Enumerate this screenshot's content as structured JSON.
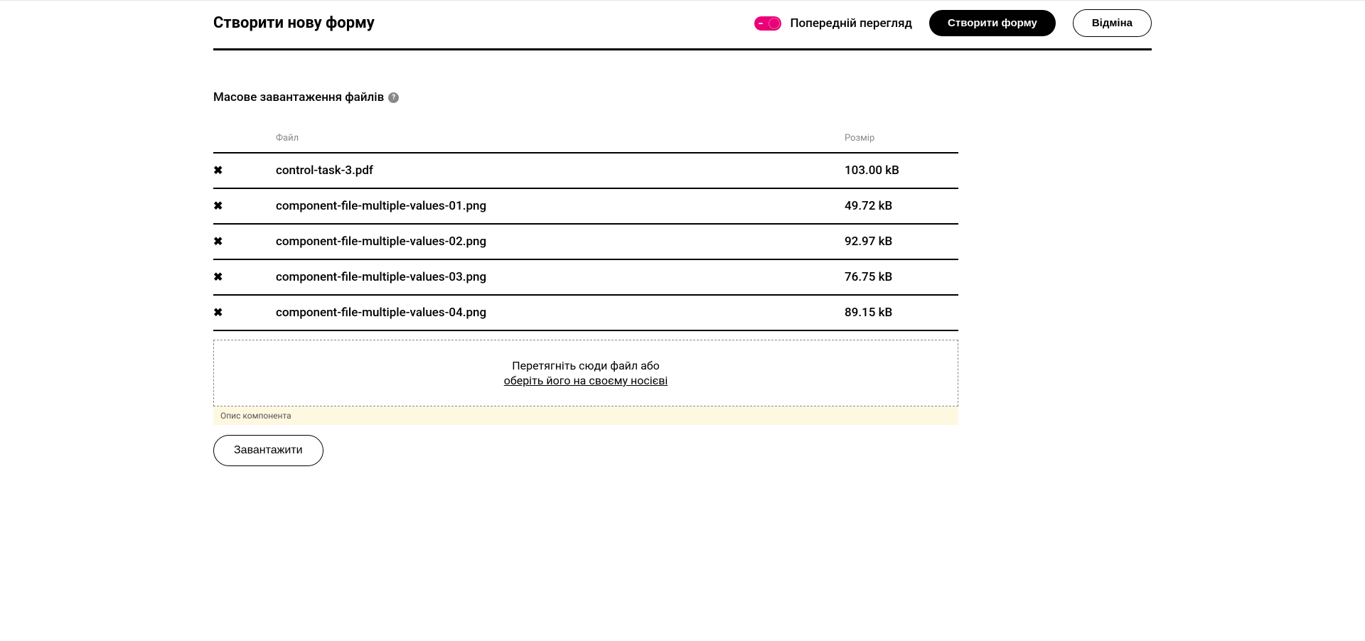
{
  "header": {
    "title": "Створити нову форму",
    "preview_label": "Попередній перегляд",
    "create_label": "Створити форму",
    "cancel_label": "Відміна"
  },
  "section": {
    "title": "Масове завантаження файлів",
    "help_glyph": "?"
  },
  "table": {
    "col_file": "Файл",
    "col_size": "Розмір",
    "rows": [
      {
        "name": "control-task-3.pdf",
        "size": "103.00 kB"
      },
      {
        "name": "component-file-multiple-values-01.png",
        "size": "49.72 kB"
      },
      {
        "name": "component-file-multiple-values-02.png",
        "size": "92.97 kB"
      },
      {
        "name": "component-file-multiple-values-03.png",
        "size": "76.75 kB"
      },
      {
        "name": "component-file-multiple-values-04.png",
        "size": "89.15 kB"
      }
    ],
    "delete_glyph": "✖"
  },
  "dropzone": {
    "text": "Перетягніть сюди файл або",
    "link": "оберіть його на своєму носієві"
  },
  "description_label": "Опис компонента",
  "upload_label": "Завантажити"
}
